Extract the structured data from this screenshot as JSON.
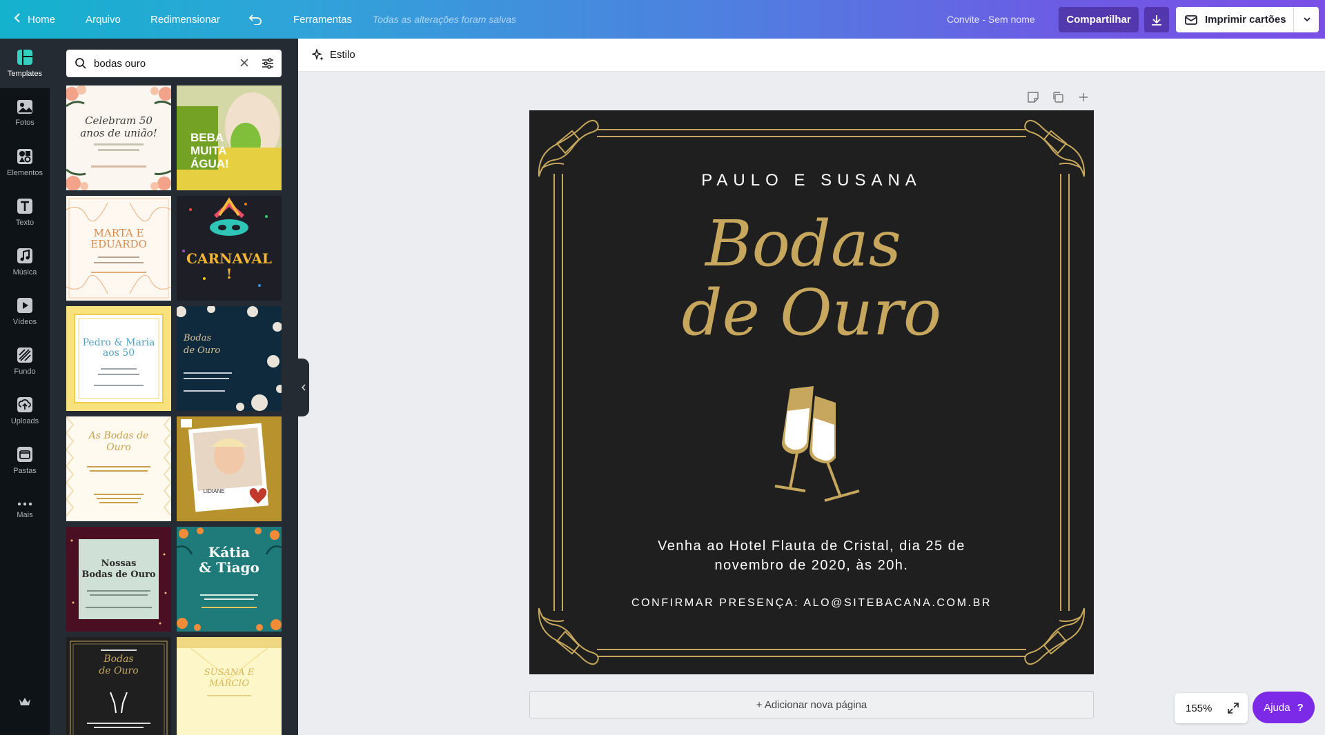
{
  "topbar": {
    "home": "Home",
    "file": "Arquivo",
    "resize": "Redimensionar",
    "tools": "Ferramentas",
    "saved_status": "Todas as alterações foram salvas",
    "doc_name": "Convite - Sem nome",
    "share": "Compartilhar",
    "print": "Imprimir cartões"
  },
  "rail": {
    "items": [
      {
        "label": "Templates",
        "icon": "templates-icon"
      },
      {
        "label": "Fotos",
        "icon": "photos-icon"
      },
      {
        "label": "Elementos",
        "icon": "elements-icon"
      },
      {
        "label": "Texto",
        "icon": "text-icon"
      },
      {
        "label": "Música",
        "icon": "music-icon"
      },
      {
        "label": "Vídeos",
        "icon": "video-icon"
      },
      {
        "label": "Fundo",
        "icon": "background-icon"
      },
      {
        "label": "Uploads",
        "icon": "upload-icon"
      },
      {
        "label": "Pastas",
        "icon": "folder-icon"
      },
      {
        "label": "Mais",
        "icon": "more-icon"
      }
    ]
  },
  "search": {
    "value": "bodas ouro"
  },
  "templates": [
    {
      "line1": "Celebram 50",
      "line2": "anos de união!"
    },
    {
      "line1": "BEBA",
      "line2": "MUITA",
      "line3": "ÁGUA!"
    },
    {
      "line1": "MARTA E",
      "line2": "EDUARDO"
    },
    {
      "line1": "CARNAVAL",
      "line2": "!"
    },
    {
      "line1": "Pedro & Maria",
      "line2": "aos 50"
    },
    {
      "line1": "Bodas",
      "line2": "de Ouro"
    },
    {
      "line1": "As Bodas de",
      "line2": "Ouro"
    },
    {
      "line1": "LIDIANE"
    },
    {
      "line1": "Nossas",
      "line2": "Bodas de Ouro"
    },
    {
      "line1": "Kátia",
      "line2": "& Tiago"
    },
    {
      "line1": "Bodas",
      "line2": "de Ouro"
    },
    {
      "line1": "SUSANA E",
      "line2": "MÁRCIO"
    }
  ],
  "context": {
    "style_label": "Estilo"
  },
  "design": {
    "names": "PAULO E SUSANA",
    "title_line1": "Bodas",
    "title_line2": "de Ouro",
    "details": "Venha ao Hotel Flauta de Cristal, dia 25 de novembro de 2020, às 20h.",
    "rsvp": "CONFIRMAR PRESENÇA: ALO@SITEBACANA.COM.BR",
    "gold": "#c6a75d",
    "background": "#1f1f1f"
  },
  "add_page": "+ Adicionar nova página",
  "zoom": "155%",
  "help": "Ajuda",
  "help_icon": "?"
}
